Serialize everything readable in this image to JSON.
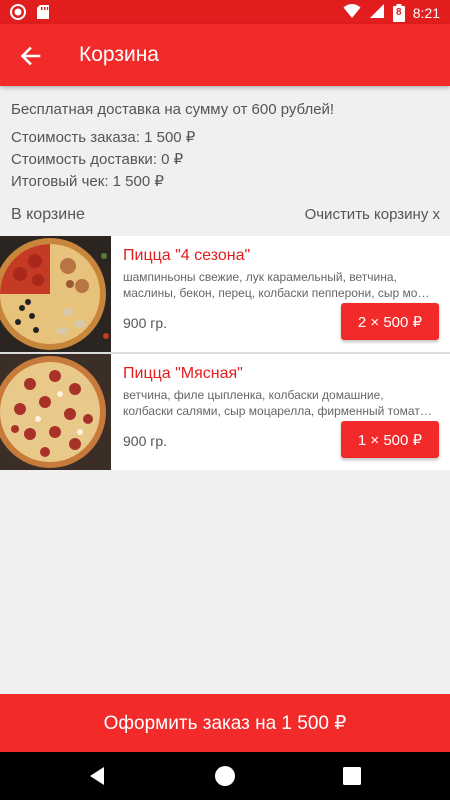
{
  "status_bar": {
    "time": "8:21",
    "battery_level": "8"
  },
  "app_bar": {
    "title": "Корзина"
  },
  "info": {
    "free_delivery": "Бесплатная доставка на сумму от 600 рублей!",
    "order_cost": "Стоимость заказа: 1 500 ₽",
    "delivery_cost": "Стоимость доставки: 0 ₽",
    "total": "Итоговый чек: 1 500 ₽"
  },
  "cart": {
    "heading": "В корзине",
    "clear_label": "Очистить корзину x",
    "items": [
      {
        "name": "Пицца \"4 сезона\"",
        "desc_line1": "шампиньоны свежие, лук карамельный, ветчина,",
        "desc_line2": "маслины, бекон, перец, колбаски пепперони, сыр мо…",
        "weight": "900 гр.",
        "qty_price": "2 × 500 ₽"
      },
      {
        "name": "Пицца \"Мясная\"",
        "desc_line1": "ветчина, филе цыпленка, колбаски домашние,",
        "desc_line2": "колбаски салями, сыр моцарелла, фирменный томат…",
        "weight": "900 гр.",
        "qty_price": "1 × 500 ₽"
      }
    ]
  },
  "checkout": {
    "label": "Оформить заказ на 1 500 ₽"
  },
  "colors": {
    "accent": "#f22a2a",
    "status_bar": "#e11d1d",
    "item_name": "#e11d1d"
  }
}
